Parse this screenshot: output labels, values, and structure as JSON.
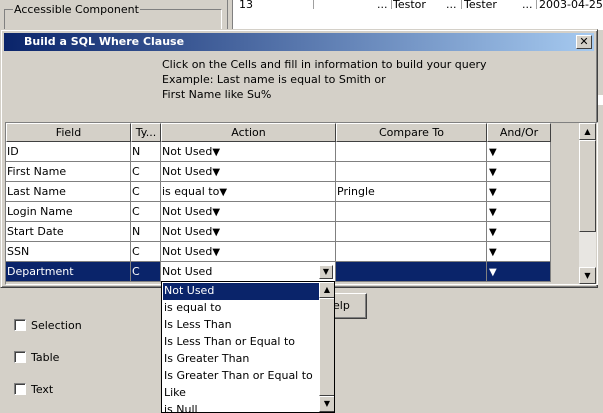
{
  "background": {
    "group_label": "Accessible Component",
    "table_row": {
      "cell1": "13",
      "cell2": "...",
      "cell3": "Testor",
      "cell4": "...",
      "cell5": "Tester",
      "cell6": "...",
      "cell7": "2003-04-25"
    },
    "checkboxes": [
      {
        "label": "Selection"
      },
      {
        "label": "Table"
      },
      {
        "label": "Text"
      }
    ],
    "help_button_label": "elp"
  },
  "dialog": {
    "title": "Build a SQL Where Clause",
    "close_glyph": "✕",
    "instructions": [
      "Click on the Cells and fill in information to build your query",
      "Example: Last name is equal to Smith or",
      "First Name like Su%"
    ]
  },
  "grid": {
    "columns": [
      "Field",
      "Ty...",
      "Action",
      "Compare To",
      "And/Or"
    ],
    "dropdown_arrow": "▼",
    "rows": [
      {
        "field": "ID",
        "type": "N",
        "action": "Not Used",
        "compare": ""
      },
      {
        "field": "First Name",
        "type": "C",
        "action": "Not Used",
        "compare": ""
      },
      {
        "field": "Last Name",
        "type": "C",
        "action": "is equal to",
        "compare": "Pringle"
      },
      {
        "field": "Login Name",
        "type": "C",
        "action": "Not Used",
        "compare": ""
      },
      {
        "field": "Start Date",
        "type": "N",
        "action": "Not Used",
        "compare": ""
      },
      {
        "field": "SSN",
        "type": "C",
        "action": "Not Used",
        "compare": ""
      },
      {
        "field": "Department",
        "type": "C",
        "action": "Not Used",
        "compare": ""
      }
    ],
    "selected_row_index": 6
  },
  "action_dropdown": {
    "selected": "Not Used",
    "options": [
      "Not Used",
      "is equal to",
      "Is Less Than",
      "Is Less Than or Equal to",
      "Is Greater Than",
      "Is Greater Than or Equal to",
      "Like",
      "is Null"
    ]
  },
  "colors": {
    "title_start": "#0a246a",
    "title_end": "#a6caf0",
    "selection": "#0a246a",
    "face": "#d4d0c8"
  }
}
